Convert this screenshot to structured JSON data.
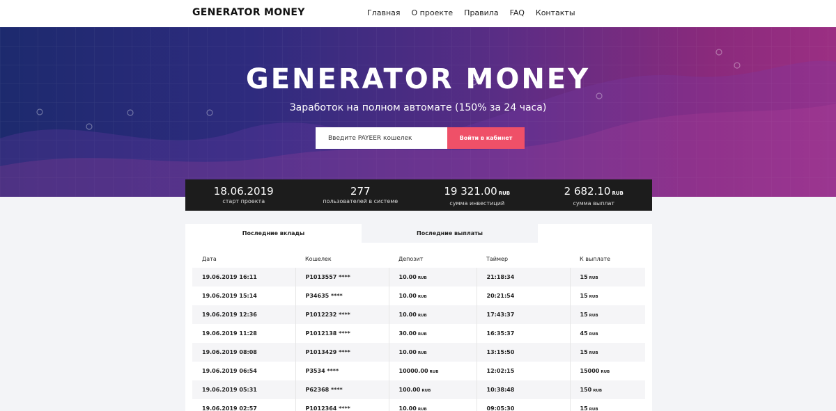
{
  "header": {
    "logo": "GENERATOR MONEY",
    "nav": [
      "Главная",
      "О проекте",
      "Правила",
      "FAQ",
      "Контакты"
    ]
  },
  "hero": {
    "title": "GENERATOR MONEY",
    "subtitle": "Заработок на полном автомате (150% за 24 часа)",
    "wallet_placeholder": "Введите PAYEER кошелек",
    "login_button": "Войти в кабинет"
  },
  "stats": [
    {
      "value": "18.06.2019",
      "currency": "",
      "label": "старт проекта"
    },
    {
      "value": "277",
      "currency": "",
      "label": "пользователей в системе"
    },
    {
      "value": "19 321.00",
      "currency": "RUB",
      "label": "сумма инвестиций"
    },
    {
      "value": "2 682.10",
      "currency": "RUB",
      "label": "сумма выплат"
    }
  ],
  "tabs": [
    "Последние вклады",
    "Последние выплаты"
  ],
  "table": {
    "headers": [
      "Дата",
      "Кошелек",
      "Депозит",
      "Таймер",
      "К выплате"
    ],
    "currency": "RUB",
    "rows": [
      [
        "19.06.2019 16:11",
        "P1013557 ****",
        "10.00",
        "21:18:34",
        "15"
      ],
      [
        "19.06.2019 15:14",
        "P34635 ****",
        "10.00",
        "20:21:54",
        "15"
      ],
      [
        "19.06.2019 12:36",
        "P1012232 ****",
        "10.00",
        "17:43:37",
        "15"
      ],
      [
        "19.06.2019 11:28",
        "P1012138 ****",
        "30.00",
        "16:35:37",
        "45"
      ],
      [
        "19.06.2019 08:08",
        "P1013429 ****",
        "10.00",
        "13:15:50",
        "15"
      ],
      [
        "19.06.2019 06:54",
        "P3534 ****",
        "10000.00",
        "12:02:15",
        "15000"
      ],
      [
        "19.06.2019 05:31",
        "P62368 ****",
        "100.00",
        "10:38:48",
        "150"
      ],
      [
        "19.06.2019 02:57",
        "P1012364 ****",
        "10.00",
        "09:05:30",
        "15"
      ]
    ]
  },
  "colors": {
    "accent": "#ef5068",
    "stats_bg": "#1c1c1c"
  }
}
